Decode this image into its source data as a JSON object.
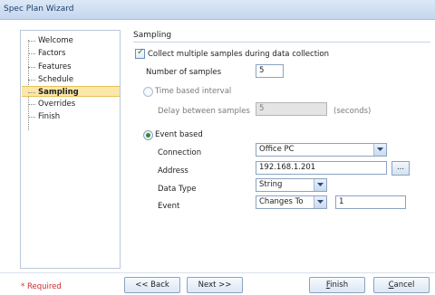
{
  "window": {
    "title": "Spec Plan Wizard"
  },
  "tree": {
    "items": [
      {
        "label": "Welcome"
      },
      {
        "label": "Factors"
      },
      {
        "label": "Features"
      },
      {
        "label": "Schedule"
      },
      {
        "label": "Sampling",
        "selected": true
      },
      {
        "label": "Overrides"
      },
      {
        "label": "Finish"
      }
    ]
  },
  "panel": {
    "title": "Sampling",
    "multiple_samples_label": "Collect multiple samples during data collection",
    "multiple_samples_checked": true,
    "num_samples_label": "Number of samples",
    "num_samples_value": "5",
    "time_based_label": "Time based interval",
    "delay_label": "Delay between samples",
    "delay_value": "5",
    "delay_unit": "(seconds)",
    "event_based_label": "Event based",
    "connection_label": "Connection",
    "connection_value": "Office PC",
    "address_label": "Address",
    "address_value": "192.168.1.201",
    "browse_label": "...",
    "data_type_label": "Data Type",
    "data_type_value": "String",
    "event_label": "Event",
    "event_value": "Changes To",
    "event_target_value": "1"
  },
  "footer": {
    "required_label": "* Required",
    "back_label": "<< Back",
    "next_label": "Next >>",
    "finish_label_u": "F",
    "finish_label_rest": "inish",
    "cancel_label_u": "C",
    "cancel_label_rest": "ancel"
  },
  "colors": {
    "accent": "#fbe7a8",
    "required": "#cc2b2b",
    "check": "#2e7d32"
  }
}
